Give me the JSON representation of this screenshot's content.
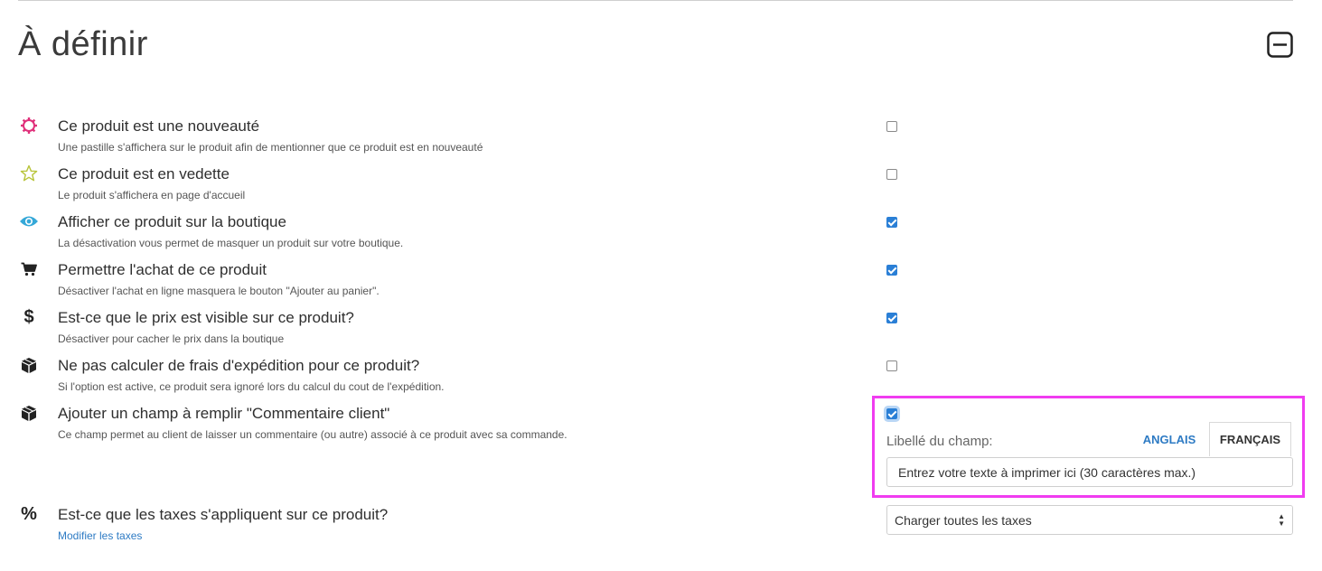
{
  "section": {
    "title": "À définir"
  },
  "options": [
    {
      "icon": "gear-outline-icon",
      "label": "Ce produit est une nouveauté",
      "help": "Une pastille s'affichera sur le produit afin de mentionner que ce produit est en nouveauté",
      "checked": false
    },
    {
      "icon": "star-outline-icon",
      "label": "Ce produit est en vedette",
      "help": "Le produit s'affichera en page d'accueil",
      "checked": false
    },
    {
      "icon": "eye-icon",
      "label": "Afficher ce produit sur la boutique",
      "help": "La désactivation vous permet de masquer un produit sur votre boutique.",
      "checked": true
    },
    {
      "icon": "cart-icon",
      "label": "Permettre l'achat de ce produit",
      "help": "Désactiver l'achat en ligne masquera le bouton \"Ajouter au panier\".",
      "checked": true
    },
    {
      "icon": "dollar-icon",
      "label": "Est-ce que le prix est visible sur ce produit?",
      "help": "Désactiver pour cacher le prix dans la boutique",
      "checked": true
    },
    {
      "icon": "box-icon",
      "label": "Ne pas calculer de frais d'expédition pour ce produit?",
      "help": "Si l'option est active, ce produit sera ignoré lors du calcul du cout de l'expédition.",
      "checked": false
    },
    {
      "icon": "box-icon",
      "label": "Ajouter un champ à remplir \"Commentaire client\"",
      "help": "Ce champ permet au client de laisser un commentaire (ou autre) associé à ce produit avec sa commande.",
      "checked": true
    }
  ],
  "comment_field": {
    "label": "Libellé du champ:",
    "tabs": [
      "ANGLAIS",
      "FRANÇAIS"
    ],
    "active_tab": "FRANÇAIS",
    "value": "Entrez votre texte à imprimer ici (30 caractères max.)"
  },
  "taxes": {
    "icon": "percent-icon",
    "label": "Est-ce que les taxes s'appliquent sur ce produit?",
    "link": "Modifier les taxes",
    "selected": "Charger toutes les taxes"
  },
  "colors": {
    "highlight": "#f03cf0",
    "accent": "#2a7fd6",
    "link": "#2e7bc4",
    "icon_pink": "#e0307a",
    "icon_olive": "#b8c43a",
    "icon_cyan": "#35a8d8"
  }
}
